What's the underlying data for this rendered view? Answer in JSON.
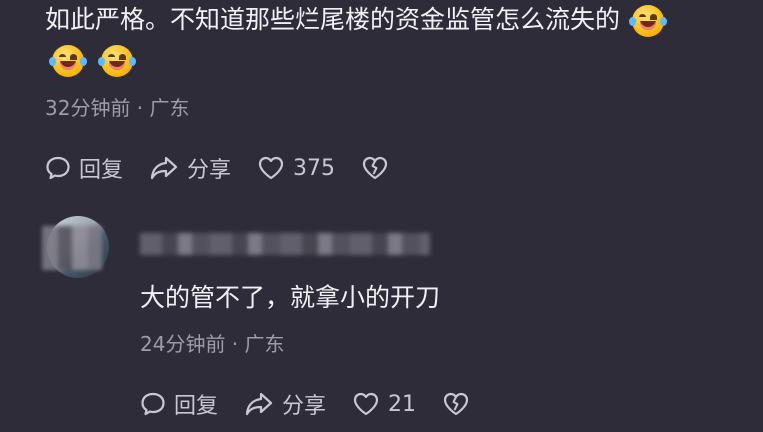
{
  "comment1": {
    "text_line1": "如此严格。不知道那些烂尾楼的资金监管怎么流失的",
    "meta": "32分钟前 · 广东",
    "actions": {
      "reply": "回复",
      "share": "分享",
      "likes": "375"
    }
  },
  "comment2": {
    "text": "大的管不了，就拿小的开刀",
    "meta": "24分钟前 · 广东",
    "actions": {
      "reply": "回复",
      "share": "分享",
      "likes": "21"
    }
  },
  "icons": {
    "emoji": "rolling-on-floor-laughing",
    "reply": "speech-bubble-icon",
    "share": "share-arrow-icon",
    "like": "heart-icon",
    "dislike": "broken-heart-icon"
  }
}
